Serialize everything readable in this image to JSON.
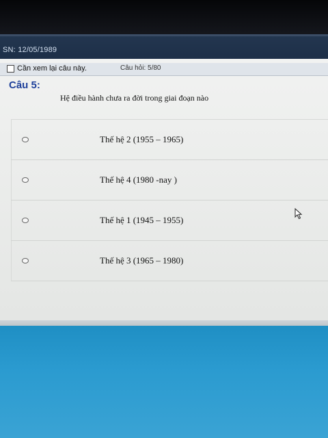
{
  "header": {
    "dob_text": "SN: 12/05/1989"
  },
  "review": {
    "label": "Cần xem lại câu này.",
    "question_count": "Câu hỏi: 5/80"
  },
  "question": {
    "number": "Câu 5:",
    "text": "Hệ điều hành chưa ra đời trong giai đoạn nào"
  },
  "options": [
    {
      "label": "Thế hệ 2 (1955 – 1965)"
    },
    {
      "label": "Thế hệ 4 (1980 -nay )"
    },
    {
      "label": "Thế hệ 1 (1945 – 1955)"
    },
    {
      "label": "Thế hệ 3 (1965 – 1980)"
    }
  ],
  "colors": {
    "accent": "#1d3f9a",
    "header_bg": "#23364f",
    "desktop_bg": "#2b9bd0"
  },
  "icons": {
    "cursor": "arrow-cursor-icon",
    "checkbox": "checkbox-icon",
    "radio": "radio-icon"
  }
}
